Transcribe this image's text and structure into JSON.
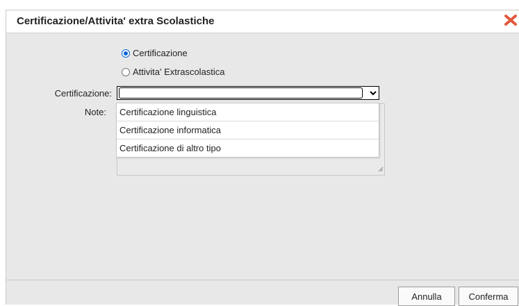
{
  "dialog": {
    "title": "Certificazione/Attivita' extra Scolastiche",
    "close_icon": "close-icon",
    "close_color": "#e2583e"
  },
  "form": {
    "radios": [
      {
        "label": "Certificazione",
        "checked": true
      },
      {
        "label": "Attivita' Extrascolastica",
        "checked": false
      }
    ],
    "certificazione_label": "Certificazione:",
    "certificazione_value": "",
    "note_label": "Note:",
    "dropdown_options": [
      "Certificazione linguistica",
      "Certificazione informatica",
      "Certificazione di altro tipo"
    ]
  },
  "footer": {
    "cancel_label": "Annulla",
    "confirm_label": "Conferma"
  }
}
